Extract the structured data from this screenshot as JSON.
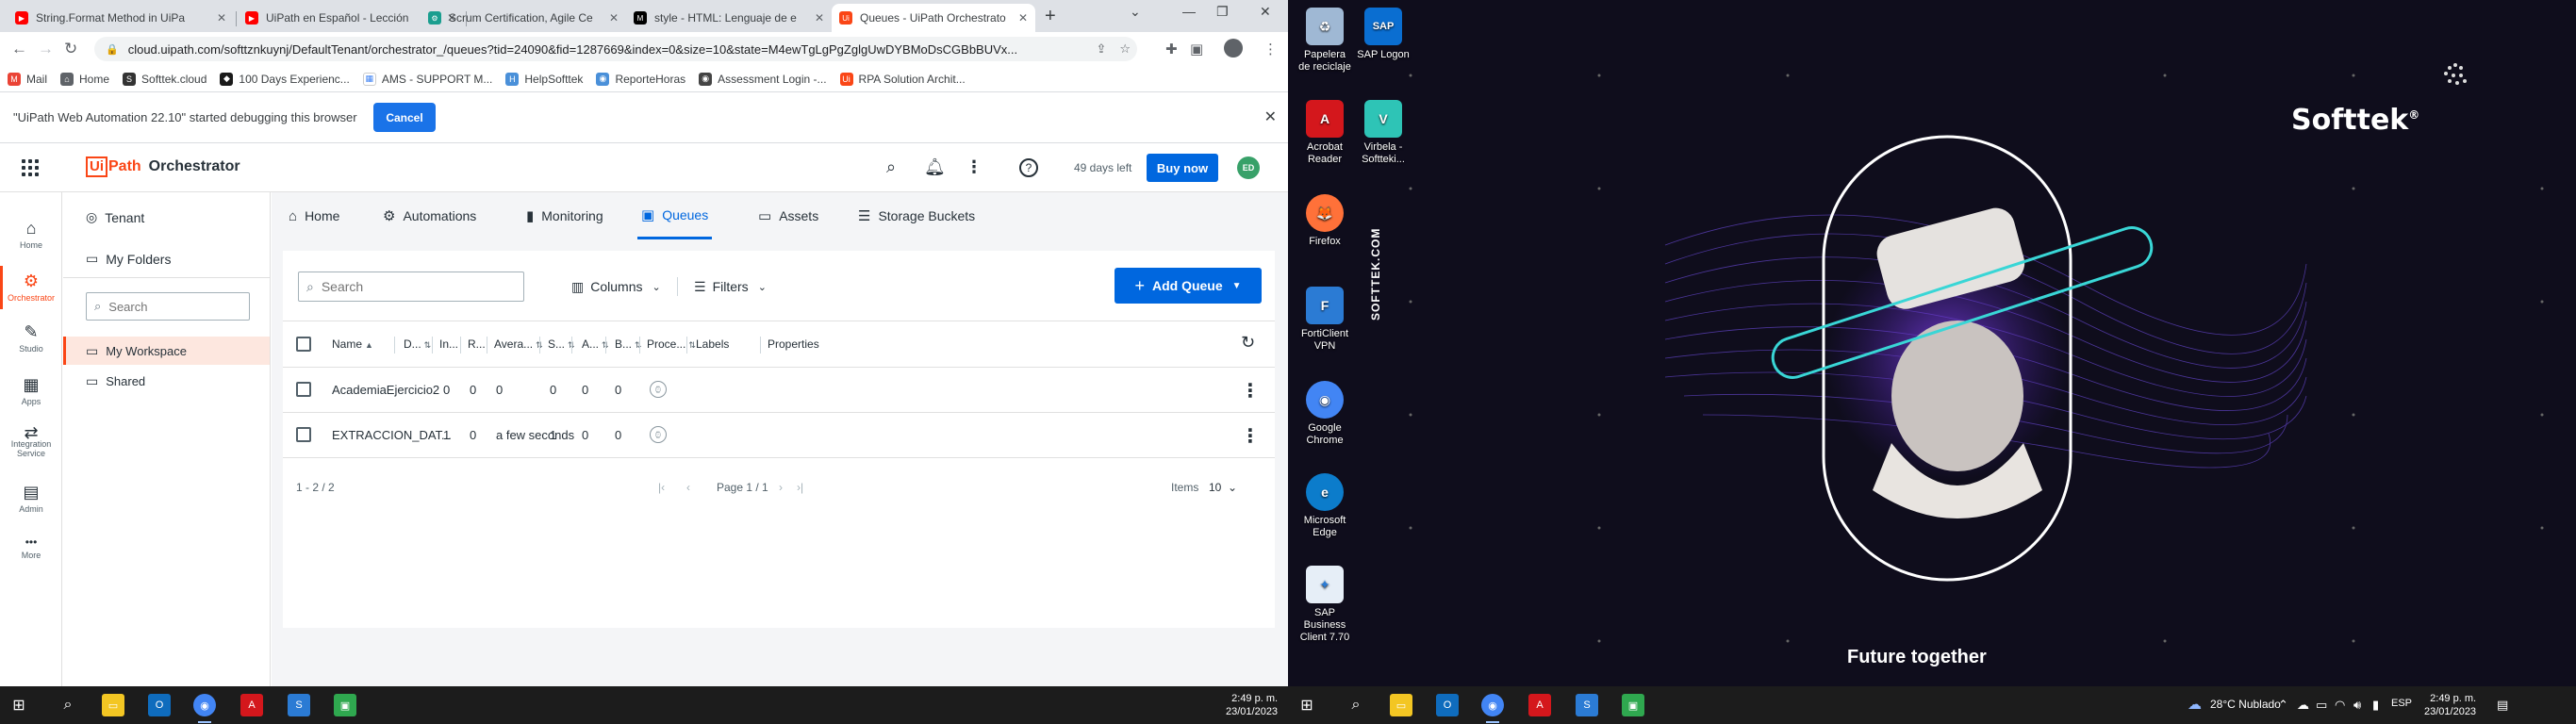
{
  "browser": {
    "tabs": [
      {
        "label": "String.Format Method in UiPa",
        "color": "#ff0000",
        "glyph": "▶"
      },
      {
        "label": "UiPath en Español - Lección",
        "color": "#ff0000",
        "glyph": "▶"
      },
      {
        "label": "Scrum Certification, Agile Ce",
        "color": "#1a9e8f",
        "glyph": "⚙"
      },
      {
        "label": "style - HTML: Lenguaje de e",
        "color": "#000000",
        "glyph": "M"
      },
      {
        "label": "Queues - UiPath Orchestrato",
        "color": "#fa4616",
        "glyph": "Ui"
      }
    ],
    "url": "cloud.uipath.com/softtznkuynj/DefaultTenant/orchestrator_/queues?tid=24090&fid=1287669&index=0&size=10&state=M4ewTgLgPgZglgUwDYBMoDsCGBbBUVx...",
    "bookmarks": [
      {
        "label": "Mail",
        "color": "#ea4335",
        "glyph": "M"
      },
      {
        "label": "Home",
        "color": "#5f6368",
        "glyph": "⌂"
      },
      {
        "label": "Softtek.cloud",
        "color": "#333333",
        "glyph": "S"
      },
      {
        "label": "100 Days Experienc...",
        "color": "#1a1a1a",
        "glyph": "◆"
      },
      {
        "label": "AMS - SUPPORT M...",
        "color": "#ffffff",
        "glyph": "▦"
      },
      {
        "label": "HelpSofttek",
        "color": "#4a90d9",
        "glyph": "H"
      },
      {
        "label": "ReporteHoras",
        "color": "#4a90d9",
        "glyph": "◉"
      },
      {
        "label": "Assessment Login -...",
        "color": "#444444",
        "glyph": "◉"
      },
      {
        "label": "RPA Solution Archit...",
        "color": "#fa4616",
        "glyph": "Ui"
      }
    ]
  },
  "debug": {
    "message": "\"UiPath Web Automation 22.10\" started debugging this browser",
    "cancel": "Cancel"
  },
  "header": {
    "logo_ui": "Ui",
    "logo_path": "Path",
    "product": "Orchestrator",
    "trial": "49 days left",
    "buy": "Buy now",
    "user_initials": "ED"
  },
  "rail": [
    {
      "label": "Home",
      "icon": "⌂"
    },
    {
      "label": "Orchestrator",
      "icon": "⚙"
    },
    {
      "label": "Studio",
      "icon": "✎"
    },
    {
      "label": "Apps",
      "icon": "▦"
    },
    {
      "label": "Integration Service",
      "icon": "⇄"
    },
    {
      "label": "Admin",
      "icon": "▤"
    },
    {
      "label": "More",
      "icon": "•••"
    }
  ],
  "folders": {
    "tenant": "Tenant",
    "my_folders": "My Folders",
    "search_placeholder": "Search",
    "workspace": "My Workspace",
    "shared": "Shared"
  },
  "nav": {
    "home": "Home",
    "automations": "Automations",
    "monitoring": "Monitoring",
    "queues": "Queues",
    "assets": "Assets",
    "storage": "Storage Buckets"
  },
  "toolbar": {
    "search_placeholder": "Search",
    "columns": "Columns",
    "filters": "Filters",
    "add_queue": "Add Queue"
  },
  "table": {
    "headers": {
      "name": "Name",
      "d": "D...",
      "in": "In...",
      "r": "R...",
      "avg": "Avera...",
      "s": "S...",
      "a": "A...",
      "b": "B...",
      "proc": "Proce...",
      "labels": "Labels",
      "props": "Properties"
    },
    "rows": [
      {
        "name": "AcademiaEjercicio2",
        "in": "0",
        "r": "0",
        "avg": "0",
        "s": "0",
        "a": "0",
        "b": "0"
      },
      {
        "name": "EXTRACCION_DAT...",
        "in": "1",
        "r": "0",
        "avg": "a few seconds",
        "s": "1",
        "a": "0",
        "b": "0"
      }
    ]
  },
  "pager": {
    "range": "1 - 2 / 2",
    "page": "Page 1 / 1",
    "items_label": "Items",
    "items_value": "10"
  },
  "taskbar": {
    "time": "2:49 p. m.",
    "date": "23/01/2023",
    "weather": "28°C  Nublado",
    "lang": "ESP"
  },
  "desktop": {
    "icons": [
      {
        "label": "Papelera de reciclaje",
        "color": "#9fb8d4",
        "glyph": "♻"
      },
      {
        "label": "SAP Logon",
        "color": "#0a6ed1",
        "glyph": "SAP"
      },
      {
        "label": "Acrobat Reader",
        "color": "#d4171c",
        "glyph": "A"
      },
      {
        "label": "Virbela - Softteki...",
        "color": "#2ec4b6",
        "glyph": "V"
      },
      {
        "label": "Firefox",
        "color": "#ff7139",
        "glyph": "🦊"
      },
      {
        "label": "FortiClient VPN",
        "color": "#2b7bd4",
        "glyph": "F"
      },
      {
        "label": "Google Chrome",
        "color": "#4285f4",
        "glyph": "◉"
      },
      {
        "label": "Microsoft Edge",
        "color": "#0c7ccb",
        "glyph": "e"
      },
      {
        "label": "SAP Business Client 7.70",
        "color": "#e6eef7",
        "glyph": "✦"
      }
    ],
    "brand": "Softtek",
    "vertical": "SOFTTEK.COM",
    "tagline": "Future together"
  }
}
